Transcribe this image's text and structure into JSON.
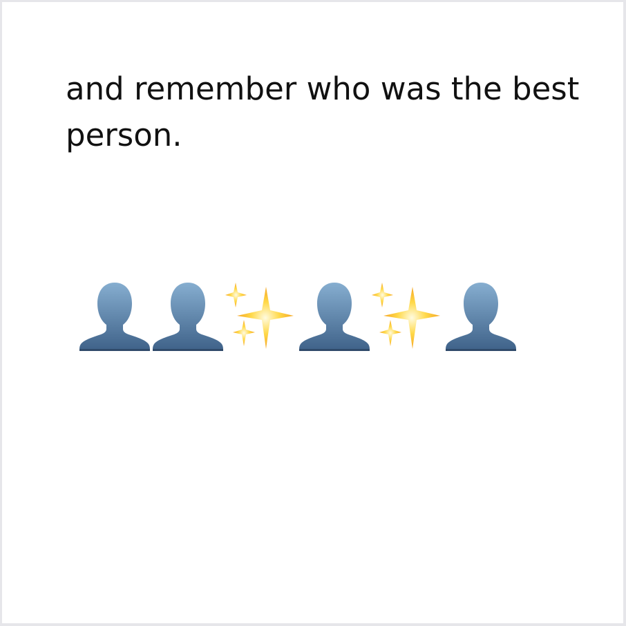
{
  "caption": {
    "text": "and remember who was the best person."
  },
  "emoji_row": [
    {
      "icon": "bust-in-silhouette-icon"
    },
    {
      "icon": "bust-in-silhouette-icon"
    },
    {
      "icon": "sparkles-icon"
    },
    {
      "icon": "bust-in-silhouette-icon"
    },
    {
      "icon": "sparkles-icon"
    },
    {
      "icon": "bust-in-silhouette-icon"
    }
  ],
  "colors": {
    "silhouette_top": "#86aed0",
    "silhouette_bottom": "#3f6289",
    "sparkle_core": "#fff7a8",
    "sparkle_edge": "#f5a623",
    "text": "#111111",
    "background": "#ffffff"
  }
}
